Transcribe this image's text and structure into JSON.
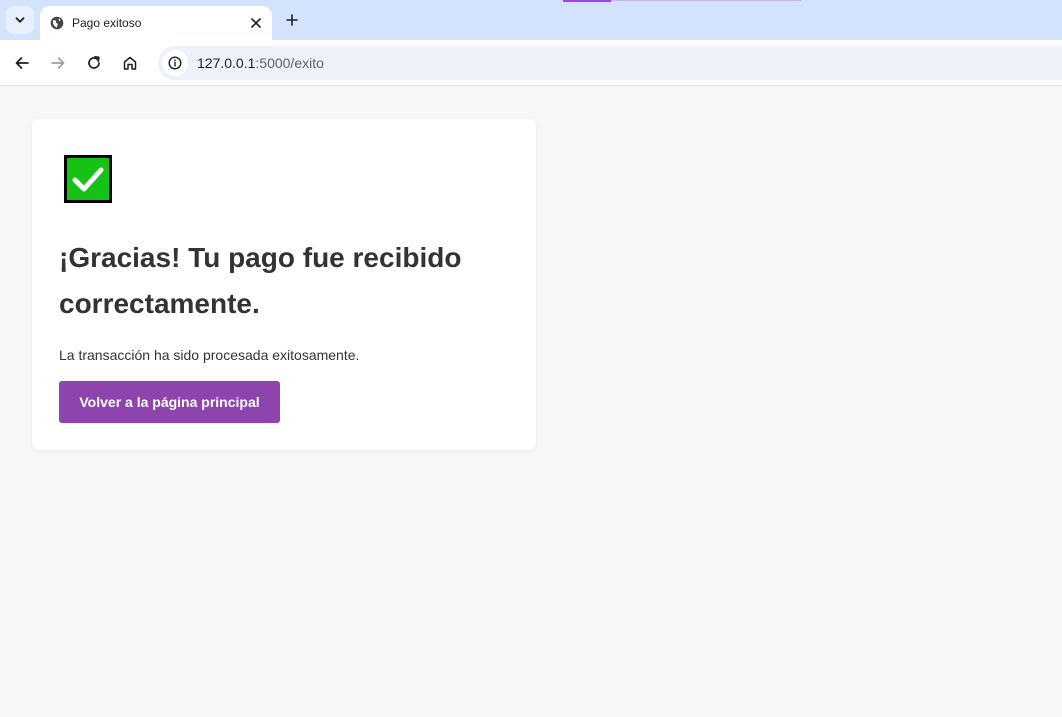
{
  "browser": {
    "tab_title": "Pago exitoso",
    "url_host": "127.0.0.1",
    "url_path": ":5000/exito"
  },
  "page": {
    "heading": "¡Gracias! Tu pago fue recibido correctamente.",
    "message": "La transacción ha sido procesada exitosamente.",
    "button_label": "Volver a la página principal",
    "success_icon": "check-mark-icon",
    "colors": {
      "button": "#8e44ad",
      "check_fill": "#15c215",
      "background": "#f7f7f7"
    }
  }
}
